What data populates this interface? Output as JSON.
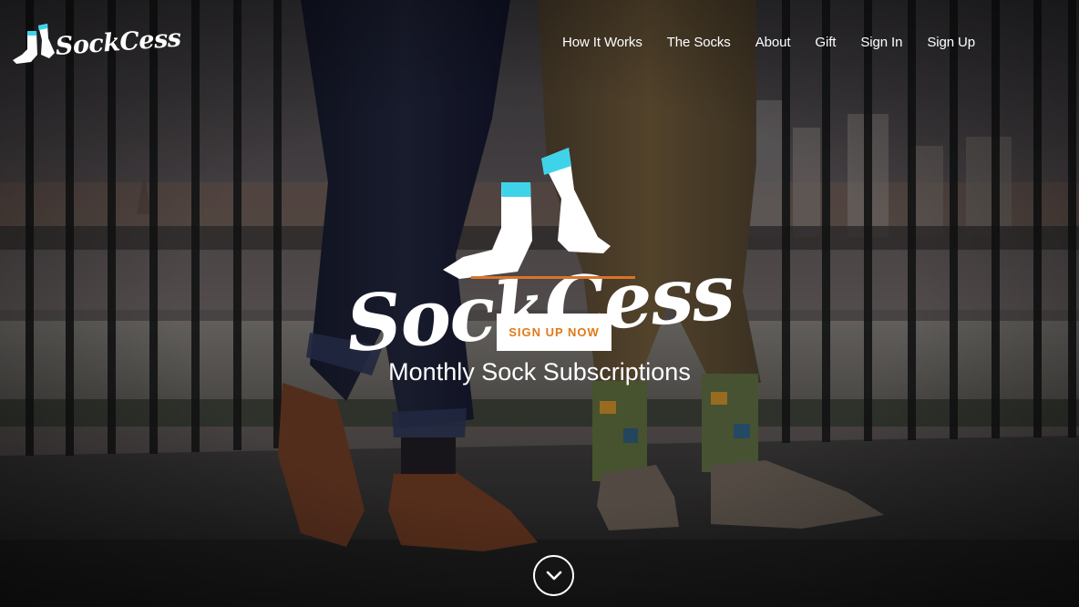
{
  "brand": {
    "name": "SockCess",
    "tagline": "Monthly Sock Subscriptions"
  },
  "nav": {
    "items": [
      {
        "label": "How It Works"
      },
      {
        "label": "The Socks"
      },
      {
        "label": "About"
      },
      {
        "label": "Gift"
      },
      {
        "label": "Sign In"
      },
      {
        "label": "Sign Up"
      }
    ]
  },
  "hero": {
    "cta_label": "SIGN UP NOW",
    "scroll_icon": "chevron-down-icon"
  },
  "colors": {
    "accent_orange": "#e07a18",
    "sock_cuff_cyan": "#3fd3ea",
    "text": "#ffffff"
  }
}
